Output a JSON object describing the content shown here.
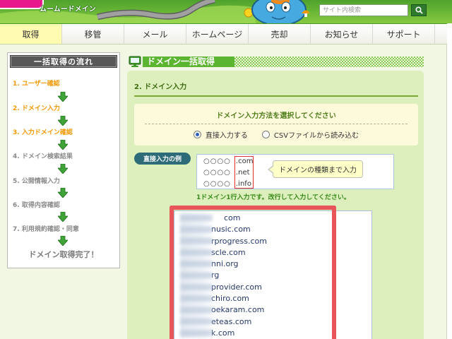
{
  "header": {
    "logo_text": "ムームードメイン",
    "search_placeholder": "サイト内検索",
    "search_icon": "search-icon"
  },
  "nav": {
    "tabs": [
      {
        "label": "取得",
        "active": true
      },
      {
        "label": "移管",
        "active": false
      },
      {
        "label": "メール",
        "active": false
      },
      {
        "label": "ホームページ",
        "active": false
      },
      {
        "label": "売却",
        "active": false
      },
      {
        "label": "お知らせ",
        "active": false
      },
      {
        "label": "サポート",
        "active": false
      }
    ]
  },
  "sidebar": {
    "title": "一括取得の流れ",
    "steps": [
      {
        "label": "1. ユーザー確認",
        "completed": true
      },
      {
        "label": "2. ドメイン入力",
        "completed": true
      },
      {
        "label": "3. 入力ドメイン確認",
        "completed": true
      },
      {
        "label": "4. ドメイン検索結果",
        "completed": false
      },
      {
        "label": "5. 公開情報入力",
        "completed": false
      },
      {
        "label": "6. 取得内容確認",
        "completed": false
      },
      {
        "label": "7. 利用規約確認・同意",
        "completed": false
      }
    ],
    "arrow_icon": "down-arrow-icon",
    "final_step": "ドメイン取得完了！"
  },
  "main": {
    "heading": "ドメイン一括取得",
    "heading_icon": "monitor-icon",
    "section_title": "2. ドメイン入力",
    "input_method": {
      "prompt": "ドメイン入力方法を選択してください",
      "options": [
        {
          "label": "直接入力する",
          "selected": true
        },
        {
          "label": "CSVファイルから読み込む",
          "selected": false
        }
      ]
    },
    "example": {
      "badge": "直接入力の例",
      "lines": [
        {
          "name": "○○○○",
          "tld": ".com"
        },
        {
          "name": "○○○○",
          "tld": ".net"
        },
        {
          "name": "○○○○",
          "tld": ".info"
        }
      ],
      "callout": "ドメインの種類まで入力"
    },
    "instruction": "1ドメイン1行入力です。改行して入力してください。",
    "domain_input": {
      "lines": [
        "com",
        "nusic.com",
        "rprogress.com",
        "scle.com",
        "nni.org",
        "rg",
        "provider.com",
        "chiro.com",
        "oekaram.com",
        "eteas.com",
        "k.com"
      ]
    }
  },
  "colors": {
    "header_green": "#6dbb3c",
    "active_tab": "#fffbb0",
    "step_done": "#f39800",
    "step_pending": "#8a8a8a",
    "heading_green": "#5cb531",
    "panel_green": "#dcefbc",
    "badge_teal": "#2d6b78",
    "instruction_green": "#3a8a1a",
    "highlight_red": "#e8565a"
  }
}
